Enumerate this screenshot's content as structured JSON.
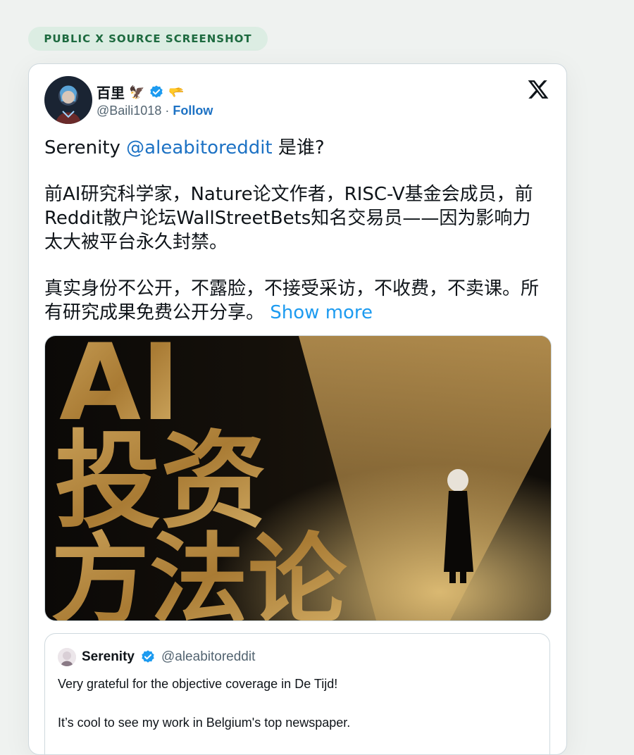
{
  "badge": "PUBLIC X SOURCE SCREENSHOT",
  "tweet": {
    "author_name": "百里",
    "author_emojis": [
      "🦅",
      "🫳"
    ],
    "handle": "@Baili1018",
    "separator": "·",
    "follow_label": "Follow",
    "paragraph1_prefix": "Serenity ",
    "paragraph1_mention": "@aleabitoreddit",
    "paragraph1_suffix": " 是谁?",
    "paragraph2": "前AI研究科学家，Nature论文作者，RISC-V基金会成员，前Reddit散户论坛WallStreetBets知名交易员——因为影响力太大被平台永久封禁。",
    "paragraph3": "真实身份不公开，不露脸，不接受采访，不收费，不卖课。所有研究成果免费公开分享。",
    "show_more": "Show more",
    "media": {
      "line1": "AI",
      "line2": "投资",
      "line3": "方法论"
    }
  },
  "quote": {
    "name": "Serenity",
    "handle": "@aleabitoreddit",
    "line1": "Very grateful for the objective coverage in De Tijd!",
    "line2": "It’s cool to see my work in Belgium's top newspaper."
  },
  "icons": {
    "verified": "verified-badge-icon",
    "x_logo": "x-logo-icon"
  },
  "colors": {
    "link": "#1d72c4",
    "show_more": "#1d9bf0",
    "verified": "#1d9bf0",
    "badge_text": "#1d6a3f",
    "gold": "#b8893a"
  }
}
